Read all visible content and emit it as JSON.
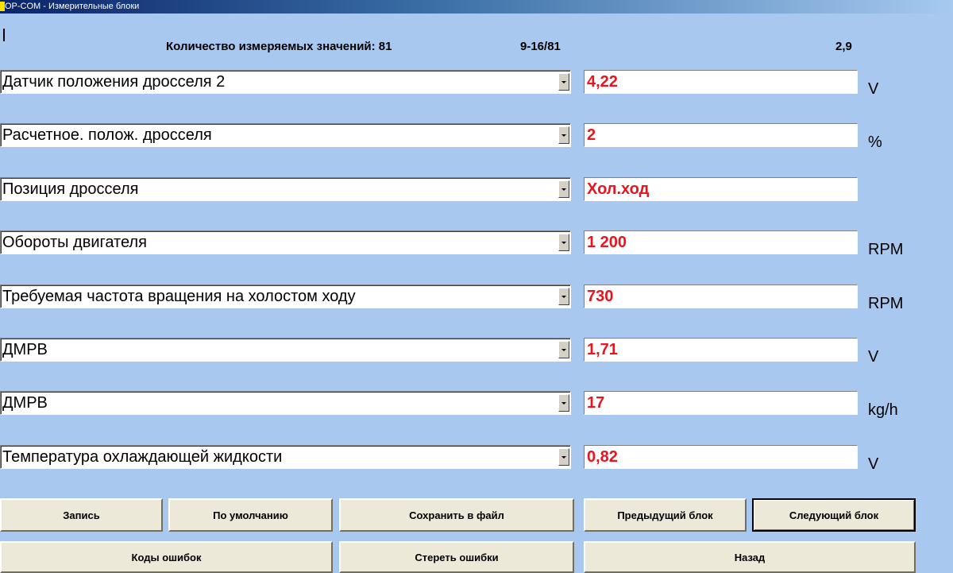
{
  "window": {
    "title": "OP-COM - Измерительные блоки"
  },
  "header": {
    "count_label": "Количество измеряемых значений: 81",
    "page_range": "9-16/81",
    "rate": "2,9"
  },
  "rows": [
    {
      "param": "Датчик положения дросселя 2",
      "value": "4,22",
      "unit": "V"
    },
    {
      "param": "Расчетное. полож. дросселя",
      "value": "2",
      "unit": "%"
    },
    {
      "param": "Позиция дросселя",
      "value": "Хол.ход",
      "unit": ""
    },
    {
      "param": "Обороты двигателя",
      "value": "1 200",
      "unit": "RPM"
    },
    {
      "param": "Требуемая частота вращения на холостом ходу",
      "value": "730",
      "unit": "RPM"
    },
    {
      "param": "ДМРВ",
      "value": "1,71",
      "unit": "V"
    },
    {
      "param": "ДМРВ",
      "value": "17",
      "unit": "kg/h"
    },
    {
      "param": "Температура охлаждающей жидкости",
      "value": "0,82",
      "unit": "V"
    }
  ],
  "buttons": {
    "record": "Запись",
    "defaults": "По умолчанию",
    "save_to_file": "Сохранить в файл",
    "prev_block": "Предыдущий блок",
    "next_block": "Следующий блок",
    "error_codes": "Коды ошибок",
    "clear_errors": "Стереть ошибки",
    "back": "Назад"
  },
  "colors": {
    "background": "#a8c8f0",
    "value_text": "#e8141e",
    "button_face": "#ece9d8"
  }
}
